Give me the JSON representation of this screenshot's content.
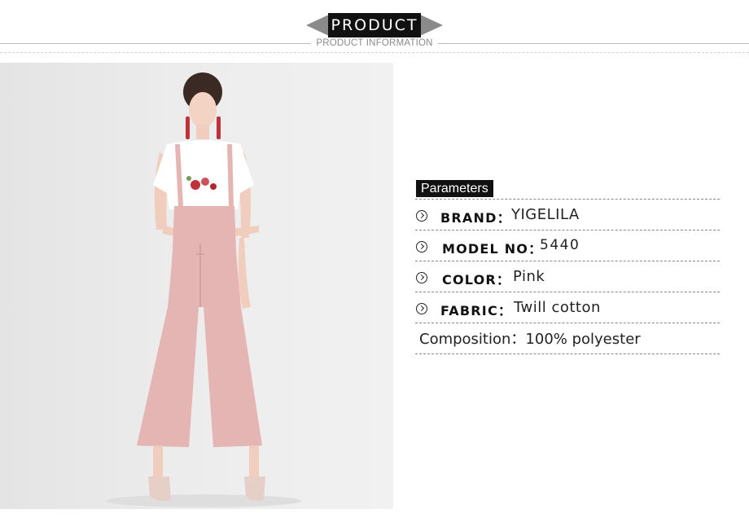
{
  "header": {
    "title": "PRODUCT",
    "subtitle": "PRODUCT INFORMATION"
  },
  "photo": {
    "description_icon": "model-photo",
    "colors": {
      "jumpsuit": "#e5b5b3",
      "top": "#ffffff",
      "background": "#ebebeb"
    }
  },
  "parameters": {
    "title": "Parameters",
    "rows": [
      {
        "label": "BRAND：",
        "value": "YIGELILA"
      },
      {
        "label": "MODEL NO：",
        "value": "5440"
      },
      {
        "label": "COLOR：",
        "value": "Pink"
      },
      {
        "label": "FABRIC：",
        "value": "Twill cotton"
      }
    ],
    "composition": "Composition：100% polyester"
  }
}
